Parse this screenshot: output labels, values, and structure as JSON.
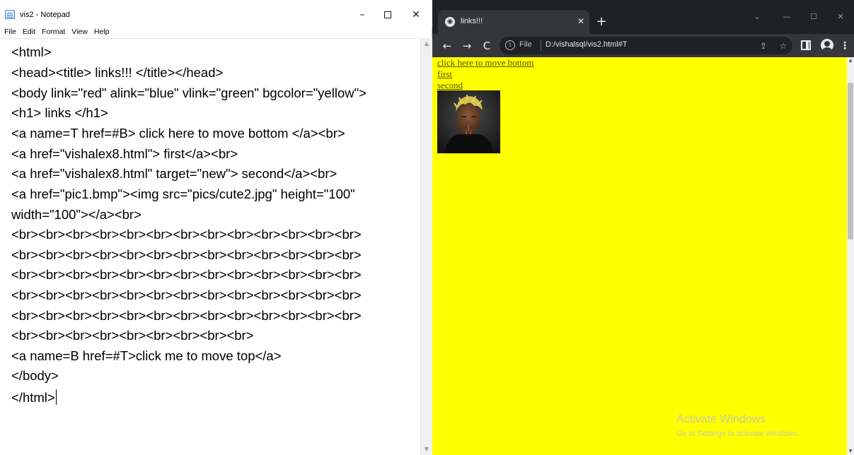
{
  "notepad": {
    "title": "vis2 - Notepad",
    "controls": {
      "minimize": "–",
      "maximize": "",
      "close": "✕"
    },
    "menu": [
      "File",
      "Edit",
      "Format",
      "View",
      "Help"
    ],
    "lines": [
      "<html>",
      "<head><title> links!!! </title></head>",
      "<body link=\"red\" alink=\"blue\" vlink=\"green\" bgcolor=\"yellow\">",
      "<h1> links </h1>",
      "<a name=T href=#B> click here to move bottom </a><br>",
      "<a href=\"vishalex8.html\"> first</a><br>",
      "<a href=\"vishalex8.html\" target=\"new\"> second</a><br>",
      "<a href=\"pic1.bmp\"><img src=\"pics/cute2.jpg\" height=\"100\"",
      "width=\"100\"></a><br>",
      "<br><br><br><br><br><br><br><br><br><br><br><br><br>",
      "<br><br><br><br><br><br><br><br><br><br><br><br><br>",
      "<br><br><br><br><br><br><br><br><br><br><br><br><br>",
      "<br><br><br><br><br><br><br><br><br><br><br><br><br>",
      "<br><br><br><br><br><br><br><br><br><br><br><br><br>",
      "<br><br><br><br><br><br><br><br><br>",
      "<a name=B href=#T>click me to move top</a>",
      "</body>",
      "</html>"
    ]
  },
  "chrome": {
    "tab": {
      "title": "links!!!",
      "favicon": "globe-icon"
    },
    "new_tab": "+",
    "nav": {
      "back": "←",
      "forward": "→",
      "reload": "C"
    },
    "omnibox": {
      "scheme": "File",
      "url": "D:/vishalsql/vis2.html#T"
    },
    "icons": {
      "share": "share-icon",
      "star": "☆",
      "menu": "⋮"
    },
    "page": {
      "background": "#ffff00",
      "links": [
        "click here to move bottom",
        "first",
        "second"
      ]
    },
    "watermark": {
      "title": "Activate Windows",
      "subtitle": "Go to Settings to activate Windows."
    }
  }
}
